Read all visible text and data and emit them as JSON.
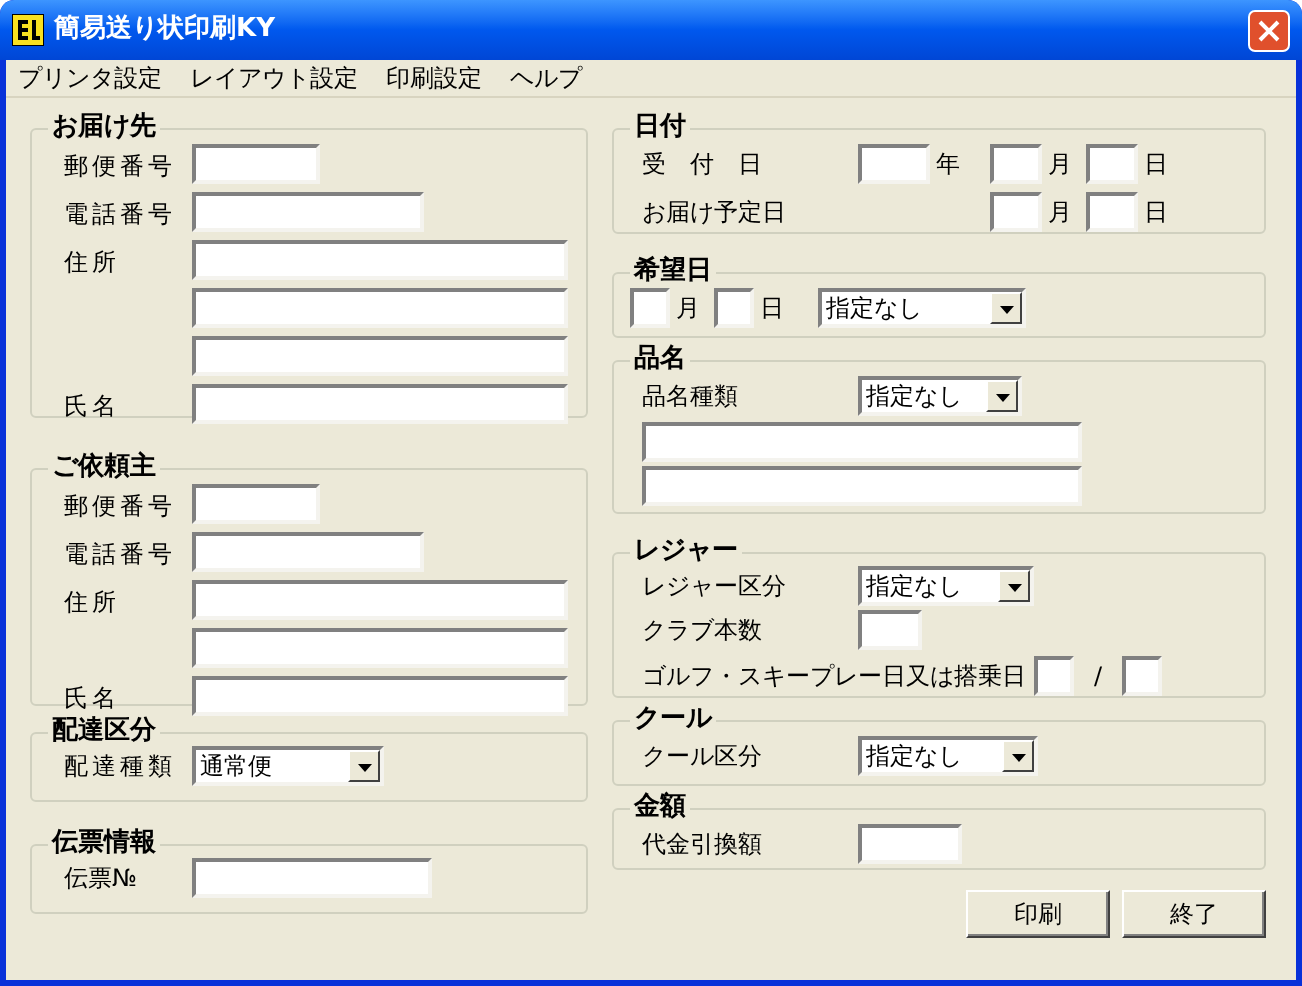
{
  "window": {
    "title": "簡易送り状印刷KY"
  },
  "menu": [
    "プリンタ設定",
    "レイアウト設定",
    "印刷設定",
    "ヘルプ"
  ],
  "recipient": {
    "title": "お届け先",
    "fields": [
      {
        "label": "郵便番号",
        "kind": "short"
      },
      {
        "label": "電話番号",
        "kind": "medium"
      },
      {
        "label": "住所",
        "kind": "long"
      },
      {
        "kind": "long"
      },
      {
        "kind": "long"
      },
      {
        "label": "氏名",
        "kind": "long"
      }
    ]
  },
  "sender": {
    "title": "ご依頼主",
    "fields": [
      {
        "label": "郵便番号",
        "kind": "short"
      },
      {
        "label": "電話番号",
        "kind": "medium"
      },
      {
        "label": "住所",
        "kind": "long"
      },
      {
        "kind": "long"
      },
      {
        "label": "氏名",
        "kind": "long"
      }
    ]
  },
  "delivery_type": {
    "title": "配達区分",
    "label": "配達種類",
    "select": "通常便"
  },
  "slip": {
    "title": "伝票情報",
    "label": "伝票№"
  },
  "date": {
    "title": "日付",
    "received": {
      "label": "受　付　日",
      "year_unit": "年",
      "month_unit": "月",
      "day_unit": "日"
    },
    "scheduled": {
      "label": "お届け予定日",
      "month_unit": "月",
      "day_unit": "日"
    }
  },
  "preferred_date": {
    "title": "希望日",
    "month_unit": "月",
    "day_unit": "日",
    "select": "指定なし"
  },
  "item": {
    "title": "品名",
    "label": "品名種類",
    "select": "指定なし"
  },
  "leisure": {
    "title": "レジャー",
    "category_label": "レジャー区分",
    "select": "指定なし",
    "clubs_label": "クラブ本数",
    "date_label": "ゴルフ・スキープレー日又は搭乗日",
    "separator": "/"
  },
  "cool": {
    "title": "クール",
    "label": "クール区分",
    "select": "指定なし"
  },
  "amount": {
    "title": "金額",
    "label": "代金引換額"
  },
  "buttons": [
    "印刷",
    "終了"
  ]
}
